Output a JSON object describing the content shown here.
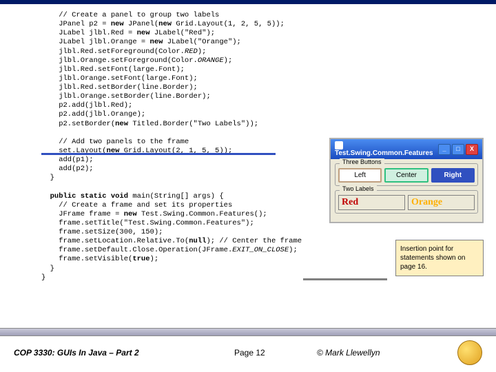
{
  "code": {
    "l1": "    // Create a panel to group two labels",
    "l2a": "    JPanel p2 = ",
    "l2b": "new",
    "l2c": " JPanel(",
    "l2d": "new",
    "l2e": " Grid.Layout(1, 2, 5, 5));",
    "l3a": "    JLabel jlbl.Red = ",
    "l3b": "new",
    "l3c": " JLabel(\"Red\");",
    "l4a": "    JLabel jlbl.Orange = ",
    "l4b": "new",
    "l4c": " JLabel(\"Orange\");",
    "l5a": "    jlbl.Red.setForeground(Color.",
    "l5b": "RED",
    "l5c": ");",
    "l6a": "    jlbl.Orange.setForeground(Color.",
    "l6b": "ORANGE",
    "l6c": ");",
    "l7": "    jlbl.Red.setFont(large.Font);",
    "l8": "    jlbl.Orange.setFont(large.Font);",
    "l9": "    jlbl.Red.setBorder(line.Border);",
    "l10": "    jlbl.Orange.setBorder(line.Border);",
    "l11": "    p2.add(jlbl.Red);",
    "l12": "    p2.add(jlbl.Orange);",
    "l13a": "    p2.setBorder(",
    "l13b": "new",
    "l13c": " Titled.Border(\"Two Labels\"));",
    "l14": "",
    "l15": "    // Add two panels to the frame",
    "l16a": "    set.Layout(",
    "l16b": "new",
    "l16c": " Grid.Layout(2, 1, 5, 5));",
    "l17": "    add(p1);",
    "l18": "    add(p2);",
    "l19": "  }",
    "l20": "",
    "l21a": "  ",
    "l21b": "public static void",
    "l21c": " main(String[] args) {",
    "l22": "    // Create a frame and set its properties",
    "l23a": "    JFrame frame = ",
    "l23b": "new",
    "l23c": " Test.Swing.Common.Features();",
    "l24": "    frame.setTitle(\"Test.Swing.Common.Features\");",
    "l25": "    frame.setSize(300, 150);",
    "l26a": "    frame.setLocation.Relative.To(",
    "l26b": "null",
    "l26c": "); // Center the frame",
    "l27a": "    frame.setDefault.Close.Operation(JFrame.",
    "l27b": "EXIT_ON_CLOSE",
    "l27c": ");",
    "l28a": "    frame.setVisible(",
    "l28b": "true",
    "l28c": ");",
    "l29": "  }",
    "l30": "}"
  },
  "window": {
    "title": "Test.Swing.Common.Features",
    "group1": "Three Buttons",
    "btn_left": "Left",
    "btn_center": "Center",
    "btn_right": "Right",
    "group2": "Two Labels",
    "label_red": "Red",
    "label_orange": "Orange"
  },
  "callout": {
    "text": "Insertion point for statements shown on page 16."
  },
  "footer": {
    "course": "COP 3330:  GUIs In Java – Part 2",
    "page": "Page 12",
    "copyright": "© Mark Llewellyn"
  }
}
